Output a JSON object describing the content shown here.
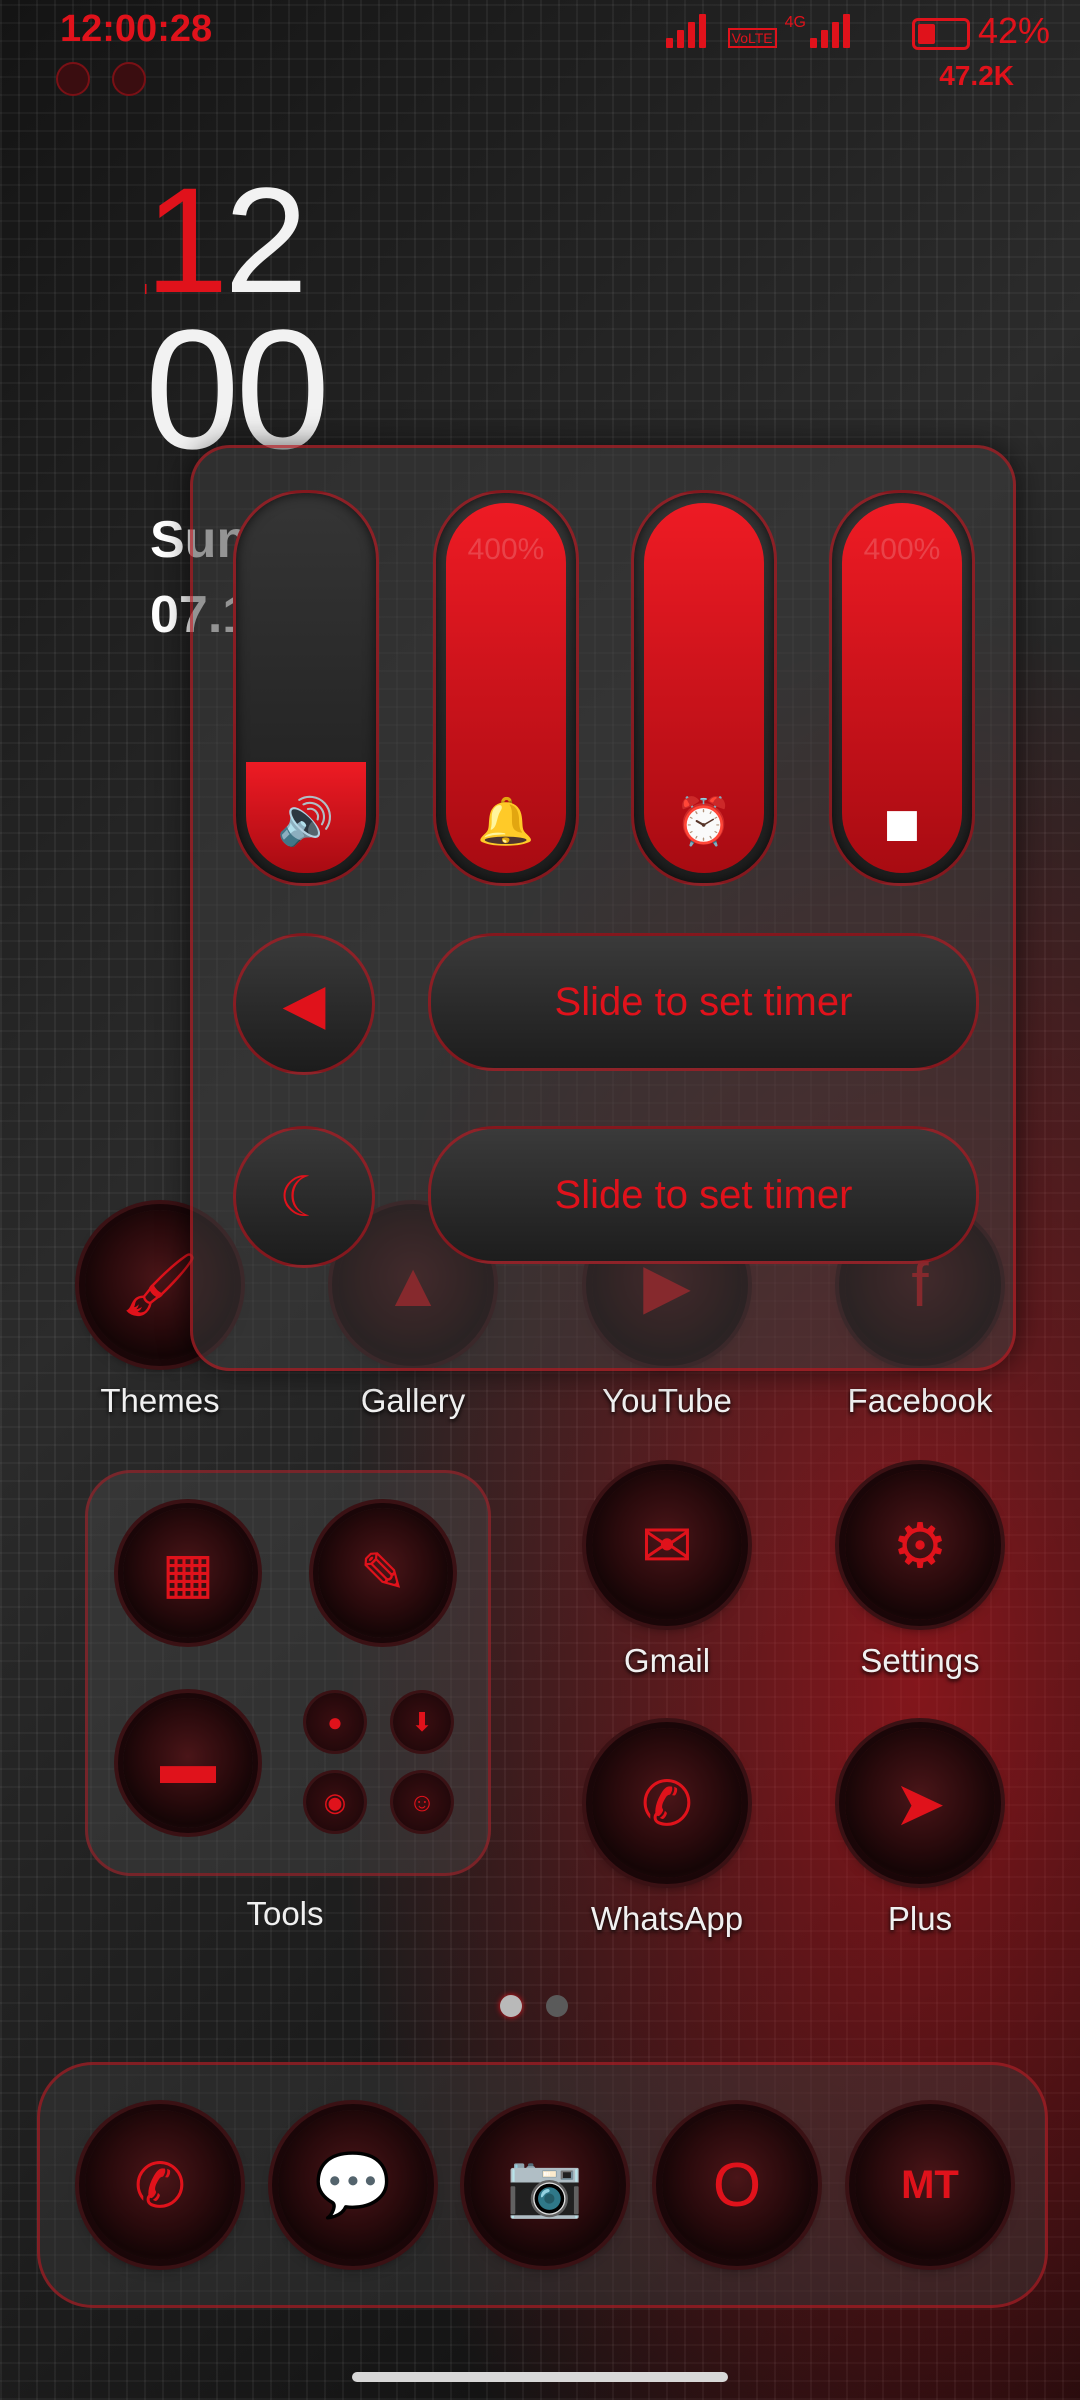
{
  "status_bar": {
    "time": "12:00:28",
    "network": "4G",
    "volte": "VoLTE",
    "battery_percent": "42%",
    "battery_level": 0.42,
    "net_speed": "47.2K"
  },
  "clock_widget": {
    "hour_1": "1",
    "hour_2": "2",
    "minutes": "00",
    "day": "Sunday",
    "date": "07.19"
  },
  "control_panel": {
    "sliders": [
      {
        "name": "media-volume",
        "icon": "speaker-icon",
        "level": 0.3
      },
      {
        "name": "ring-volume",
        "icon": "bell-icon",
        "level": 1.0,
        "percent": "400%"
      },
      {
        "name": "alarm-volume",
        "icon": "alarm-clock-icon",
        "level": 1.0
      },
      {
        "name": "notification-volume",
        "icon": "notification-icon",
        "level": 1.0,
        "percent": "400%"
      }
    ],
    "timer_1_label": "Slide to set timer",
    "timer_2_label": "Slide to set timer"
  },
  "apps": {
    "themes": "Themes",
    "gallery": "Gallery",
    "youtube": "YouTube",
    "facebook": "Facebook",
    "gmail": "Gmail",
    "settings": "Settings",
    "whatsapp": "WhatsApp",
    "plus": "Plus",
    "tools_folder": "Tools"
  },
  "dock": [
    "phone-icon",
    "messages-icon",
    "camera-icon",
    "opera-icon",
    "mt-manager-icon"
  ],
  "colors": {
    "accent": "#e0121b",
    "text": "#f0f0f0"
  }
}
